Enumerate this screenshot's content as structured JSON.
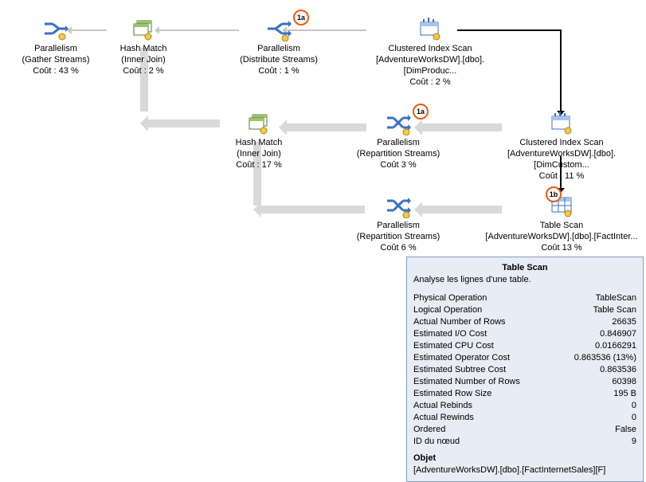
{
  "nodes": {
    "n1": {
      "title": "Parallelism",
      "sub": "(Gather Streams)",
      "cost": "Coût : 43 %"
    },
    "n2": {
      "title": "Hash Match",
      "sub": "(Inner Join)",
      "cost": "Coût : 2 %"
    },
    "n3": {
      "title": "Parallelism",
      "sub": "(Distribute Streams)",
      "cost": "Coût : 1 %",
      "badge": "1a"
    },
    "n4": {
      "title": "Clustered Index Scan",
      "sub": "[AdventureWorksDW].[dbo].[DimProduc...",
      "cost": "Coût : 2 %"
    },
    "n5": {
      "title": "Hash Match",
      "sub": "(Inner Join)",
      "cost": "Coût : 17 %"
    },
    "n6": {
      "title": "Parallelism",
      "sub": "(Repartition Streams)",
      "cost": "Coût 3 %",
      "badge": "1a"
    },
    "n7": {
      "title": "Clustered Index Scan",
      "sub": "[AdventureWorksDW].[dbo].[DimCustom...",
      "cost": "Coût : 11 %"
    },
    "n8": {
      "title": "Parallelism",
      "sub": "(Repartition Streams)",
      "cost": "Coût 6 %"
    },
    "n9": {
      "title": "Table Scan",
      "sub": "[AdventureWorksDW].[dbo].[FactInter...",
      "cost": "Coût 13 %",
      "badge": "1b"
    }
  },
  "tooltip": {
    "title": "Table Scan",
    "desc": "Analyse les lignes d'une table.",
    "rows": [
      {
        "k": "Physical Operation",
        "v": "TableScan"
      },
      {
        "k": "Logical Operation",
        "v": "Table Scan"
      },
      {
        "k": "Actual Number of Rows",
        "v": "26635"
      },
      {
        "k": "Estimated I/O Cost",
        "v": "0.846907"
      },
      {
        "k": "Estimated CPU Cost",
        "v": "0.0166291"
      },
      {
        "k": "Estimated Operator Cost",
        "v": "0.863536 (13%)"
      },
      {
        "k": "Estimated Subtree Cost",
        "v": "0.863536"
      },
      {
        "k": "Estimated Number of Rows",
        "v": "60398"
      },
      {
        "k": "Estimated Row Size",
        "v": "195 B"
      },
      {
        "k": "Actual Rebinds",
        "v": "0"
      },
      {
        "k": "Actual Rewinds",
        "v": "0"
      },
      {
        "k": "Ordered",
        "v": "False"
      },
      {
        "k": "ID du nœud",
        "v": "9"
      }
    ],
    "objLabel": "Objet",
    "obj": "[AdventureWorksDW].[dbo].[FactInternetSales][F]"
  }
}
